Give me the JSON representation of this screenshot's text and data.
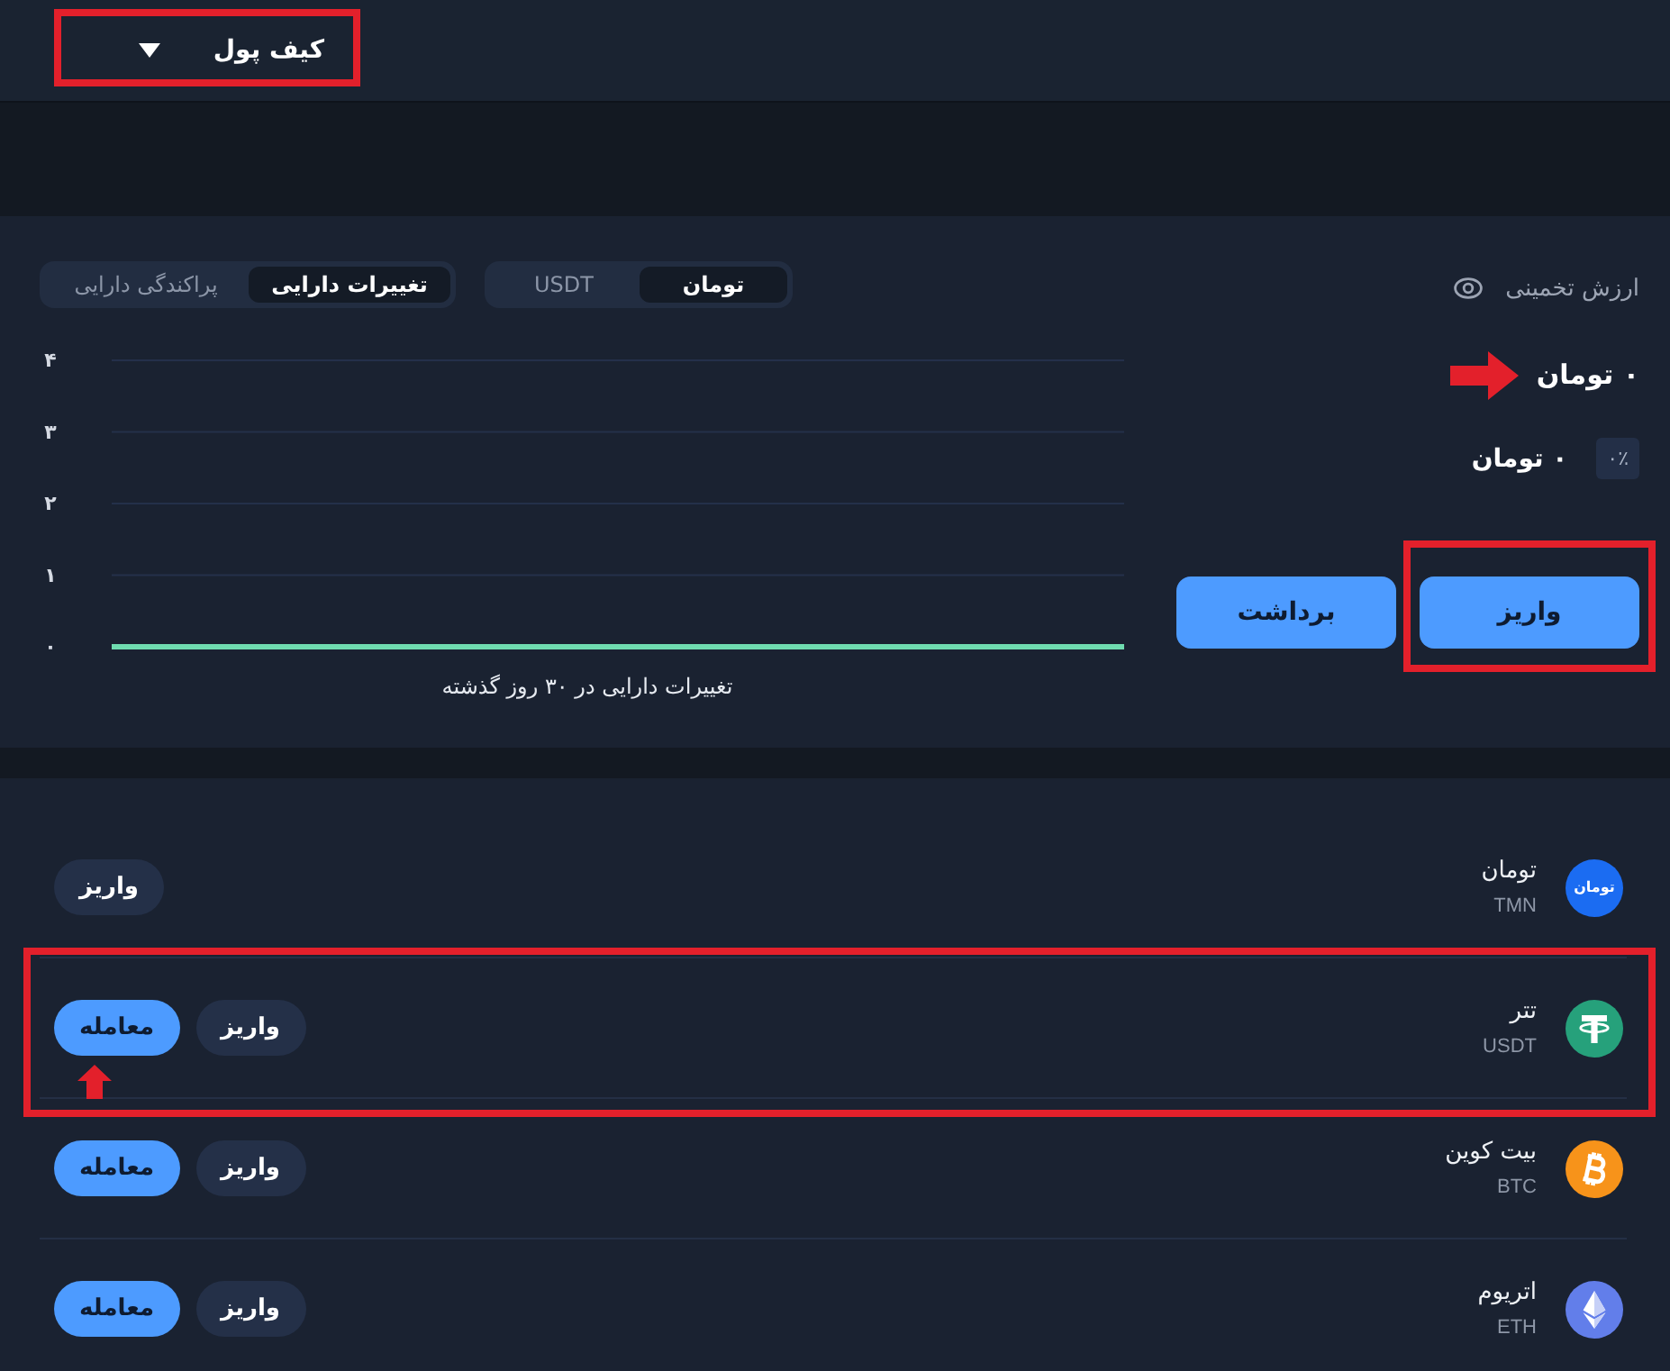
{
  "header": {
    "menu": {
      "label": "کیف پول",
      "highlighted": true
    }
  },
  "summary": {
    "estimate_label": "ارزش تخمینی",
    "balance": {
      "amount": "۰ تومان",
      "pointed": true
    },
    "change": {
      "percent": "۰٪",
      "amount": "۰ تومان"
    },
    "actions": [
      {
        "label": "واریز",
        "highlighted": true
      },
      {
        "label": "برداشت",
        "highlighted": false
      }
    ]
  },
  "currency_tabs": [
    {
      "label": "تومان",
      "selected": true
    },
    {
      "label": "USDT",
      "selected": false
    }
  ],
  "view_tabs": [
    {
      "label": "تغییرات دارایی",
      "selected": true
    },
    {
      "label": "پراکندگی دارایی",
      "selected": false
    }
  ],
  "chart": {
    "chart_data": {
      "type": "line",
      "xlabel": "تغییرات دارایی در ۳۰ روز گذشته",
      "ylim": [
        0,
        4
      ],
      "yticks": [
        {
          "value": 0,
          "label": "۰"
        },
        {
          "value": 1,
          "label": "۱"
        },
        {
          "value": 2,
          "label": "۲"
        },
        {
          "value": 3,
          "label": "۳"
        },
        {
          "value": 4,
          "label": "۴"
        }
      ],
      "grid": true,
      "series": [
        {
          "color": "#6fdcb0",
          "values": [
            0,
            0,
            0,
            0,
            0,
            0,
            0,
            0,
            0,
            0,
            0,
            0,
            0,
            0,
            0,
            0,
            0,
            0,
            0,
            0,
            0,
            0,
            0,
            0,
            0,
            0,
            0,
            0,
            0,
            0
          ]
        }
      ]
    }
  },
  "assets": [
    {
      "kind": "toman",
      "color": "#1b6cf2",
      "logo_text": "تومان",
      "name": "تومان",
      "symbol": "TMN",
      "highlighted": false,
      "buttons": [
        {
          "kind": "deposit",
          "label": "واریز",
          "pointed": false
        }
      ]
    },
    {
      "kind": "tether",
      "color": "#26a17b",
      "name": "تتر",
      "symbol": "USDT",
      "highlighted": true,
      "buttons": [
        {
          "kind": "deposit",
          "label": "واریز",
          "pointed": false
        },
        {
          "kind": "trade",
          "label": "معامله",
          "pointed": true
        }
      ]
    },
    {
      "kind": "bitcoin",
      "color": "#f7931a",
      "name": "بیت کوین",
      "symbol": "BTC",
      "highlighted": false,
      "buttons": [
        {
          "kind": "deposit",
          "label": "واریز",
          "pointed": false
        },
        {
          "kind": "trade",
          "label": "معامله",
          "pointed": false
        }
      ]
    },
    {
      "kind": "ethereum",
      "color": "#627eea",
      "name": "اتریوم",
      "symbol": "ETH",
      "highlighted": false,
      "buttons": [
        {
          "kind": "deposit",
          "label": "واریز",
          "pointed": false
        },
        {
          "kind": "trade",
          "label": "معامله",
          "pointed": false
        }
      ]
    }
  ]
}
